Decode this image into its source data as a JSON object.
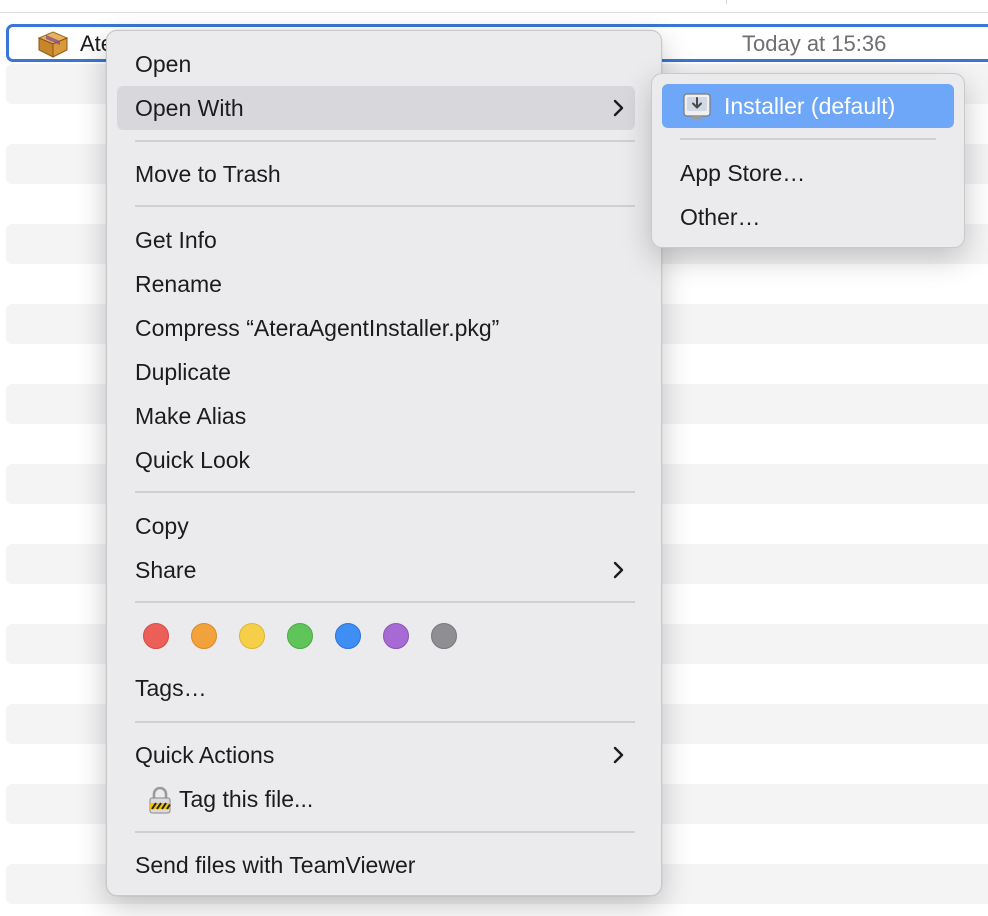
{
  "file": {
    "name": "Ate",
    "date": "Today at 15:36"
  },
  "context_menu": {
    "open": "Open",
    "open_with": "Open With",
    "move_to_trash": "Move to Trash",
    "get_info": "Get Info",
    "rename": "Rename",
    "compress": "Compress “AteraAgentInstaller.pkg”",
    "duplicate": "Duplicate",
    "make_alias": "Make Alias",
    "quick_look": "Quick Look",
    "copy": "Copy",
    "share": "Share",
    "tags": "Tags…",
    "quick_actions": "Quick Actions",
    "tag_this_file": "Tag this file...",
    "send_teamviewer": "Send files with TeamViewer",
    "tag_colors": [
      {
        "name": "red",
        "color": "#ec5f59"
      },
      {
        "name": "orange",
        "color": "#f2a23d"
      },
      {
        "name": "yellow",
        "color": "#f5cf47"
      },
      {
        "name": "green",
        "color": "#5fc55a"
      },
      {
        "name": "blue",
        "color": "#3f8ef3"
      },
      {
        "name": "purple",
        "color": "#a66ad4"
      },
      {
        "name": "gray",
        "color": "#8e8e93"
      }
    ]
  },
  "open_with_submenu": {
    "installer": "Installer (default)",
    "app_store": "App Store…",
    "other": "Other…"
  },
  "colors": {
    "selection_border": "#3a76d6",
    "submenu_highlight": "#6ea6f8",
    "menu_hover": "#d8d8dc"
  }
}
